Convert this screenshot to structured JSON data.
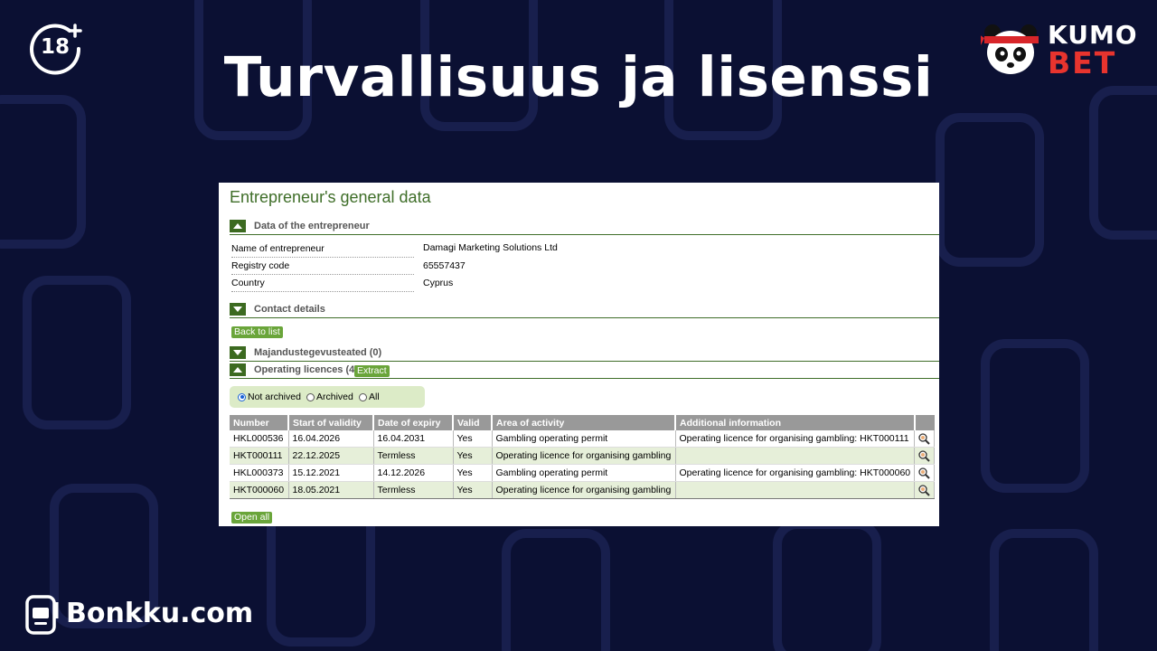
{
  "header": {
    "age_badge": "18",
    "title": "Turvallisuus ja lisenssi",
    "logo_line1": "KUMO",
    "logo_line2": "BET",
    "footer_brand": "Bonkku.com"
  },
  "panel": {
    "page_title": "Entrepreneur's general data",
    "sections": {
      "entrepreneur": "Data of the entrepreneur",
      "contact": "Contact details",
      "majandus": "Majandustegevusteated (0)",
      "licences": "Operating licences (4)"
    },
    "fields": [
      {
        "label": "Name of entrepreneur",
        "value": "Damagi Marketing Solutions Ltd"
      },
      {
        "label": "Registry code",
        "value": "65557437"
      },
      {
        "label": "Country",
        "value": "Cyprus"
      }
    ],
    "buttons": {
      "back": "Back to list",
      "extract": "Extract",
      "open_all": "Open all"
    },
    "filter": {
      "options": [
        "Not archived",
        "Archived",
        "All"
      ],
      "selected": "Not archived"
    },
    "table": {
      "columns": [
        "Number",
        "Start of validity",
        "Date of expiry",
        "Valid",
        "Area of activity",
        "Additional information"
      ],
      "rows": [
        [
          "HKL000536",
          "16.04.2026",
          "16.04.2031",
          "Yes",
          "Gambling operating permit",
          "Operating licence for organising gambling: HKT000111"
        ],
        [
          "HKT000111",
          "22.12.2025",
          "Termless",
          "Yes",
          "Operating licence for organising gambling",
          ""
        ],
        [
          "HKL000373",
          "15.12.2021",
          "14.12.2026",
          "Yes",
          "Gambling operating permit",
          "Operating licence for organising gambling: HKT000060"
        ],
        [
          "HKT000060",
          "18.05.2021",
          "Termless",
          "Yes",
          "Operating licence for organising gambling",
          ""
        ]
      ]
    }
  },
  "colors": {
    "background": "#0b1033",
    "accent_green": "#3f6e29",
    "button_green": "#6aa53a",
    "brand_red": "#e8342e"
  }
}
